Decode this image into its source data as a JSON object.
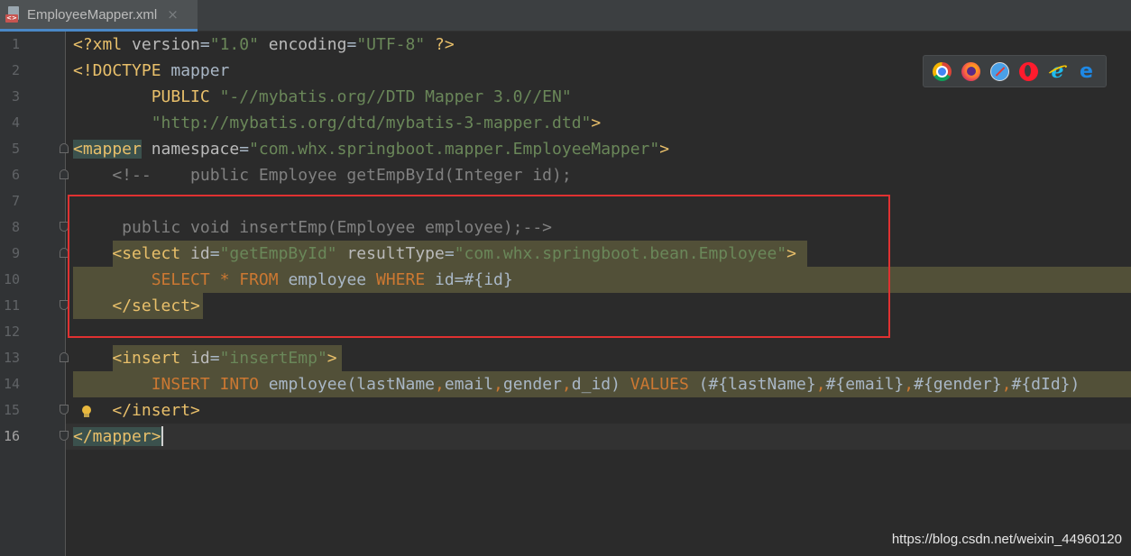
{
  "tab": {
    "file_name": "EmployeeMapper.xml",
    "file_type_badge": "<>",
    "close_glyph": "×"
  },
  "gutter": {
    "line_numbers": [
      "1",
      "2",
      "3",
      "4",
      "5",
      "6",
      "7",
      "8",
      "9",
      "10",
      "11",
      "12",
      "13",
      "14",
      "15",
      "16"
    ],
    "current_line": "16"
  },
  "code": {
    "l1": {
      "a": "<?xml ",
      "b": "version",
      "c": "=",
      "d": "\"1.0\"",
      "e": " ",
      "f": "encoding",
      "g": "=",
      "h": "\"UTF-8\"",
      "i": " ?>"
    },
    "l2": {
      "a": "<!DOCTYPE ",
      "b": "mapper"
    },
    "l3": {
      "a": "        PUBLIC ",
      "b": "\"-//mybatis.org//DTD Mapper 3.0//EN\""
    },
    "l4": {
      "a": "        ",
      "b": "\"http://mybatis.org/dtd/mybatis-3-mapper.dtd\"",
      "c": ">"
    },
    "l5": {
      "a": "<mapper",
      "b": " namespace",
      "c": "=",
      "d": "\"com.whx.springboot.mapper.EmployeeMapper\"",
      "e": ">"
    },
    "l6": {
      "a": "    <!--    public Employee getEmpById(Integer id);"
    },
    "l7": {
      "a": ""
    },
    "l8": {
      "a": "     public void insertEmp(Employee employee);-->"
    },
    "l9": {
      "a": "    ",
      "b": "<select",
      "c": " id",
      "d": "=",
      "e": "\"getEmpById\"",
      "f": " resultType",
      "g": "=",
      "h": "\"com.whx.springboot.bean.Employee\"",
      "i": ">"
    },
    "l10": {
      "a": "        ",
      "b": "SELECT",
      "c": " * ",
      "d": "FROM",
      "e": " employee ",
      "f": "WHERE",
      "g": " id=#{id}"
    },
    "l11": {
      "a": "    ",
      "b": "</select>"
    },
    "l12": {
      "a": ""
    },
    "l13": {
      "a": "    ",
      "b": "<insert",
      "c": " id",
      "d": "=",
      "e": "\"insertEmp\"",
      "f": ">"
    },
    "l14": {
      "a": "        ",
      "b": "INSERT",
      "c": " ",
      "d": "INTO",
      "e": " employee(lastName",
      "f": ",",
      "g": "email",
      "h": ",",
      "i": "gender",
      "j": ",",
      "k": "d_id) ",
      "l": "VALUES",
      "m": " (#{lastName}",
      "n": ",",
      "o": "#{email}",
      "p": ",",
      "q": "#{gender}",
      "r": ",",
      "s": "#{dId})"
    },
    "l15": {
      "a": "    ",
      "b": "</insert>"
    },
    "l16": {
      "a": "</mapper",
      "b": ">"
    }
  },
  "browser_icons": [
    "chrome-icon",
    "firefox-icon",
    "safari-icon",
    "opera-icon",
    "internet-explorer-icon",
    "edge-icon"
  ],
  "browser_glyphs": {
    "ie": "e",
    "edge": "e"
  },
  "watermark": "https://blog.csdn.net/weixin_44960120",
  "colors": {
    "tag": "#e8bf6a",
    "string": "#6a8759",
    "keyword": "#cc7832",
    "comment": "#808080",
    "highlight": "#525038",
    "annotation_box": "#e03131"
  }
}
